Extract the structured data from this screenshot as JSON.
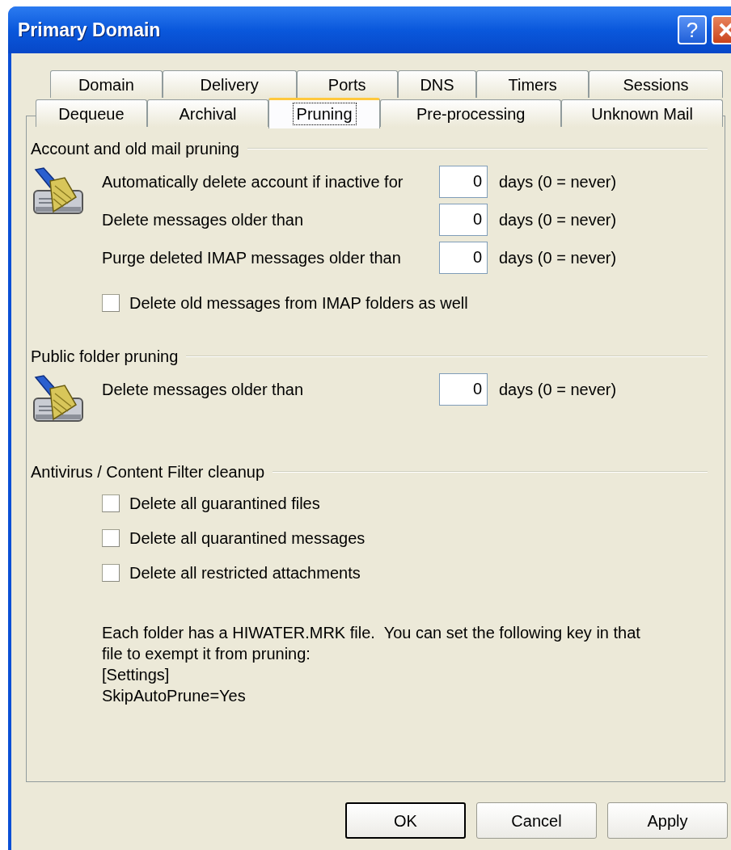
{
  "window": {
    "title": "Primary Domain",
    "help_button": "?"
  },
  "tab_rows": [
    [
      {
        "label": "Domain",
        "selected": false
      },
      {
        "label": "Delivery",
        "selected": false
      },
      {
        "label": "Ports",
        "selected": false
      },
      {
        "label": "DNS",
        "selected": false
      },
      {
        "label": "Timers",
        "selected": false
      },
      {
        "label": "Sessions",
        "selected": false
      }
    ],
    [
      {
        "label": "Dequeue",
        "selected": false
      },
      {
        "label": "Archival",
        "selected": false
      },
      {
        "label": "Pruning",
        "selected": true
      },
      {
        "label": "Pre-processing",
        "selected": false
      },
      {
        "label": "Unknown Mail",
        "selected": false
      }
    ]
  ],
  "sections": [
    {
      "title": "Account and old mail pruning",
      "has_icon": true,
      "items": [
        {
          "kind": "number_field",
          "label": "Automatically delete account if inactive for",
          "value": "0",
          "suffix": "days (0 = never)"
        },
        {
          "kind": "number_field",
          "label": "Delete messages older than",
          "value": "0",
          "suffix": "days (0 = never)"
        },
        {
          "kind": "number_field",
          "label": "Purge deleted IMAP messages older than",
          "value": "0",
          "suffix": "days (0 = never)"
        },
        {
          "kind": "checkbox",
          "label": "Delete old messages from IMAP folders as well",
          "checked": false
        }
      ]
    },
    {
      "title": "Public folder pruning",
      "has_icon": true,
      "items": [
        {
          "kind": "number_field",
          "label": "Delete messages older than",
          "value": "0",
          "suffix": "days (0 = never)"
        }
      ]
    },
    {
      "title": "Antivirus / Content Filter cleanup",
      "has_icon": false,
      "items": [
        {
          "kind": "checkbox",
          "label": "Delete all guarantined files",
          "checked": false
        },
        {
          "kind": "checkbox",
          "label": "Delete all quarantined messages",
          "checked": false
        },
        {
          "kind": "checkbox",
          "label": "Delete all restricted attachments",
          "checked": false
        },
        {
          "kind": "note",
          "lines": [
            "Each folder has a HIWATER.MRK file.  You can set the following key in that",
            "file to exempt it from pruning:",
            "[Settings]",
            "SkipAutoPrune=Yes"
          ]
        }
      ]
    }
  ],
  "buttons": [
    {
      "label": "OK",
      "default": true
    },
    {
      "label": "Cancel",
      "default": false
    },
    {
      "label": "Apply",
      "default": false
    }
  ]
}
